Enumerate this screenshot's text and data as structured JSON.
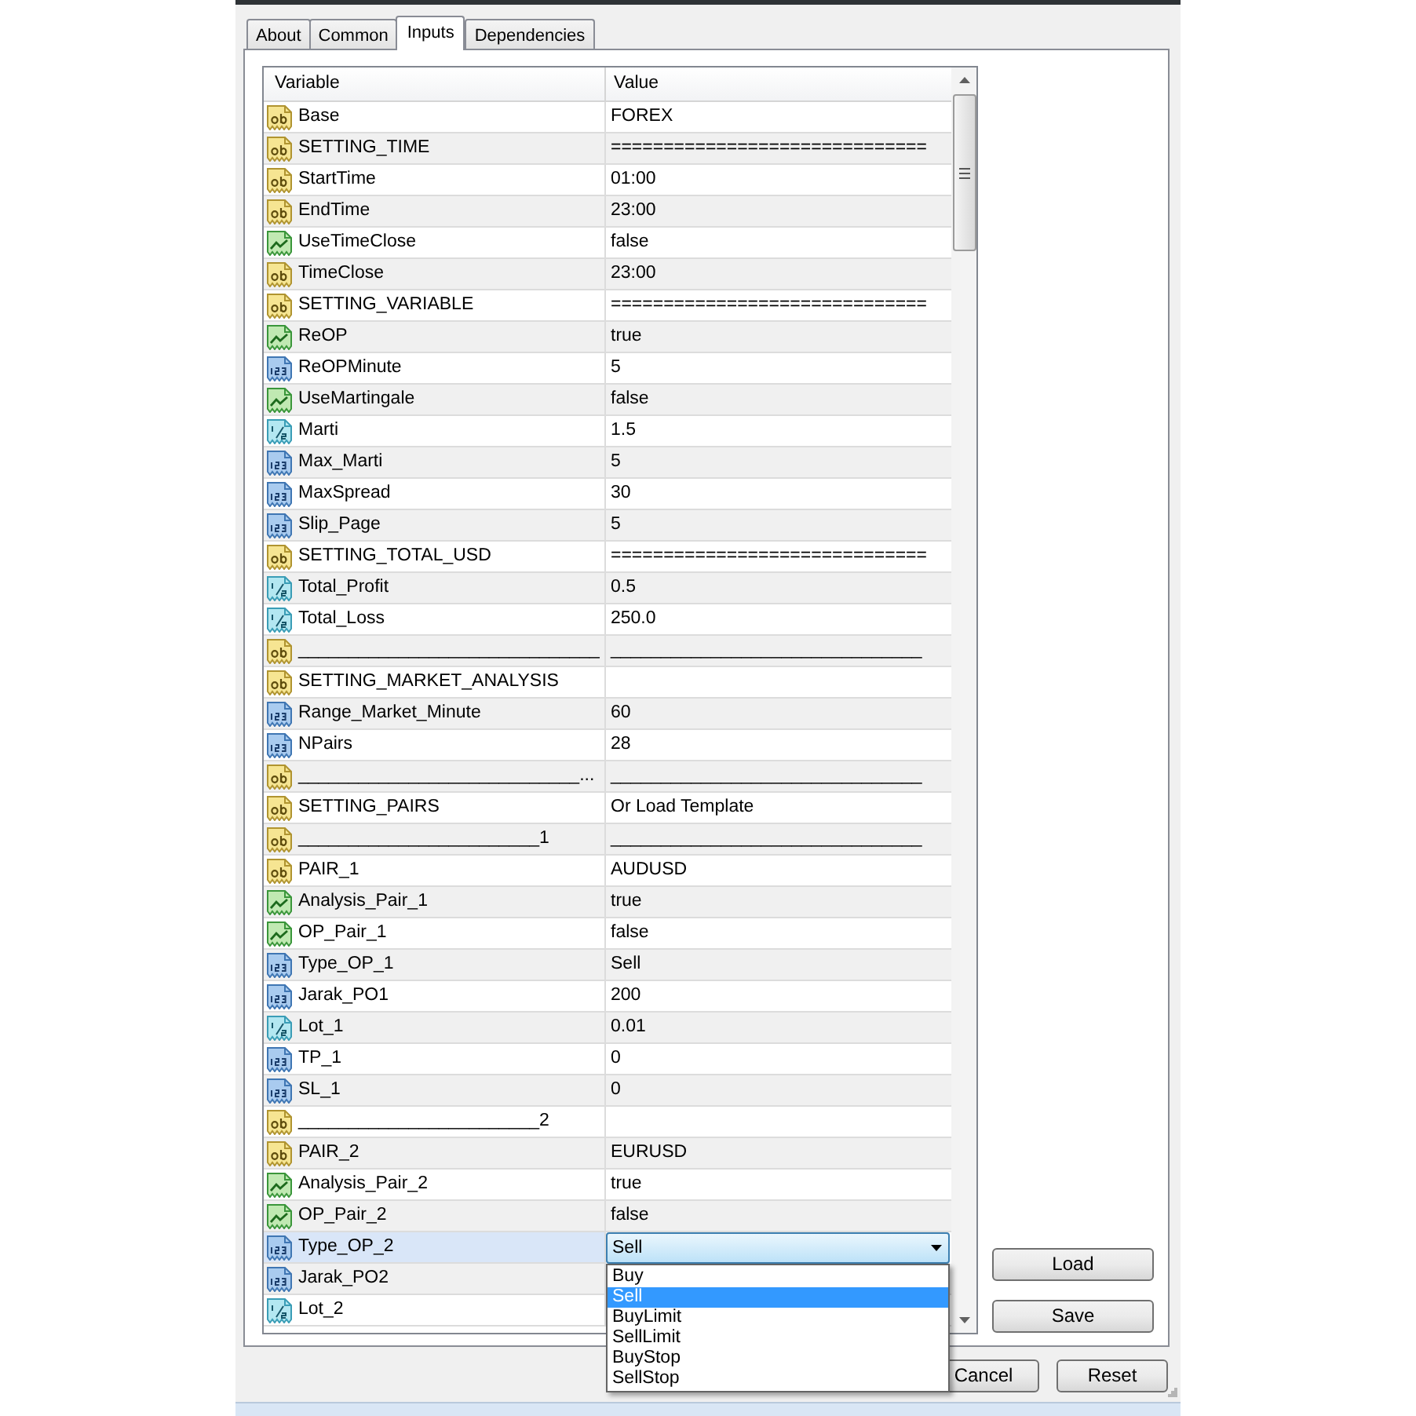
{
  "tabs": [
    {
      "label": "About",
      "selected": false
    },
    {
      "label": "Common",
      "selected": false
    },
    {
      "label": "Inputs",
      "selected": true
    },
    {
      "label": "Dependencies",
      "selected": false
    }
  ],
  "grid": {
    "columns": [
      "Variable",
      "Value"
    ],
    "rows": [
      {
        "kind": "string",
        "variable": "Base",
        "value": "FOREX",
        "selected": false
      },
      {
        "kind": "string",
        "variable": "SETTING_TIME",
        "value": "==============================",
        "selected": false
      },
      {
        "kind": "string",
        "variable": "StartTime",
        "value": "01:00",
        "selected": false
      },
      {
        "kind": "string",
        "variable": "EndTime",
        "value": "23:00",
        "selected": false
      },
      {
        "kind": "bool",
        "variable": "UseTimeClose",
        "value": "false",
        "selected": false
      },
      {
        "kind": "string",
        "variable": "TimeClose",
        "value": "23:00",
        "selected": false
      },
      {
        "kind": "string",
        "variable": "SETTING_VARIABLE",
        "value": "==============================",
        "selected": false
      },
      {
        "kind": "bool",
        "variable": "ReOP",
        "value": "true",
        "selected": false
      },
      {
        "kind": "int",
        "variable": "ReOPMinute",
        "value": "5",
        "selected": false
      },
      {
        "kind": "bool",
        "variable": "UseMartingale",
        "value": "false",
        "selected": false
      },
      {
        "kind": "double",
        "variable": "Marti",
        "value": "1.5",
        "selected": false
      },
      {
        "kind": "int",
        "variable": "Max_Marti",
        "value": "5",
        "selected": false
      },
      {
        "kind": "int",
        "variable": "MaxSpread",
        "value": "30",
        "selected": false
      },
      {
        "kind": "int",
        "variable": "Slip_Page",
        "value": "5",
        "selected": false
      },
      {
        "kind": "string",
        "variable": "SETTING_TOTAL_USD",
        "value": "==============================",
        "selected": false
      },
      {
        "kind": "double",
        "variable": "Total_Profit",
        "value": "0.5",
        "selected": false
      },
      {
        "kind": "double",
        "variable": "Total_Loss",
        "value": "250.0",
        "selected": false
      },
      {
        "kind": "string",
        "variable": "______________________________",
        "value": "_______________________________",
        "selected": false
      },
      {
        "kind": "string",
        "variable": "SETTING_MARKET_ANALYSIS",
        "selected": false
      },
      {
        "kind": "int",
        "variable": "Range_Market_Minute",
        "value": "60",
        "selected": false
      },
      {
        "kind": "int",
        "variable": "NPairs",
        "value": "28",
        "selected": false
      },
      {
        "kind": "string",
        "variable": "____________________________...",
        "value": "_______________________________",
        "selected": false
      },
      {
        "kind": "string",
        "variable": "SETTING_PAIRS",
        "value": "Or Load Template",
        "selected": false
      },
      {
        "kind": "string",
        "variable": "________________________1",
        "value": "_______________________________",
        "selected": false
      },
      {
        "kind": "string",
        "variable": "PAIR_1",
        "value": "AUDUSD",
        "selected": false
      },
      {
        "kind": "bool",
        "variable": "Analysis_Pair_1",
        "value": "true",
        "selected": false
      },
      {
        "kind": "bool",
        "variable": "OP_Pair_1",
        "value": "false",
        "selected": false
      },
      {
        "kind": "int",
        "variable": "Type_OP_1",
        "value": "Sell",
        "selected": false
      },
      {
        "kind": "int",
        "variable": "Jarak_PO1",
        "value": "200",
        "selected": false
      },
      {
        "kind": "double",
        "variable": "Lot_1",
        "value": "0.01",
        "selected": false
      },
      {
        "kind": "int",
        "variable": "TP_1",
        "value": "0",
        "selected": false
      },
      {
        "kind": "int",
        "variable": "SL_1",
        "value": "0",
        "selected": false
      },
      {
        "kind": "string",
        "variable": "________________________2",
        "selected": false
      },
      {
        "kind": "string",
        "variable": "PAIR_2",
        "value": "EURUSD",
        "selected": false
      },
      {
        "kind": "bool",
        "variable": "Analysis_Pair_2",
        "value": "true",
        "selected": false
      },
      {
        "kind": "bool",
        "variable": "OP_Pair_2",
        "value": "false",
        "selected": false
      },
      {
        "kind": "int",
        "variable": "Type_OP_2",
        "value": "Sell",
        "selected": true,
        "dropdown": {
          "expanded": true,
          "options": [
            {
              "label": "Buy",
              "selected": false
            },
            {
              "label": "Sell",
              "selected": true
            },
            {
              "label": "BuyLimit",
              "selected": false
            },
            {
              "label": "SellLimit",
              "selected": false
            },
            {
              "label": "BuyStop",
              "selected": false
            },
            {
              "label": "SellStop",
              "selected": false
            }
          ]
        }
      },
      {
        "kind": "int",
        "variable": "Jarak_PO2",
        "selected": false
      },
      {
        "kind": "double",
        "variable": "Lot_2",
        "selected": false
      }
    ]
  },
  "side_buttons": [
    "Load",
    "Save"
  ],
  "footer_buttons": [
    "Cancel",
    "Reset"
  ]
}
